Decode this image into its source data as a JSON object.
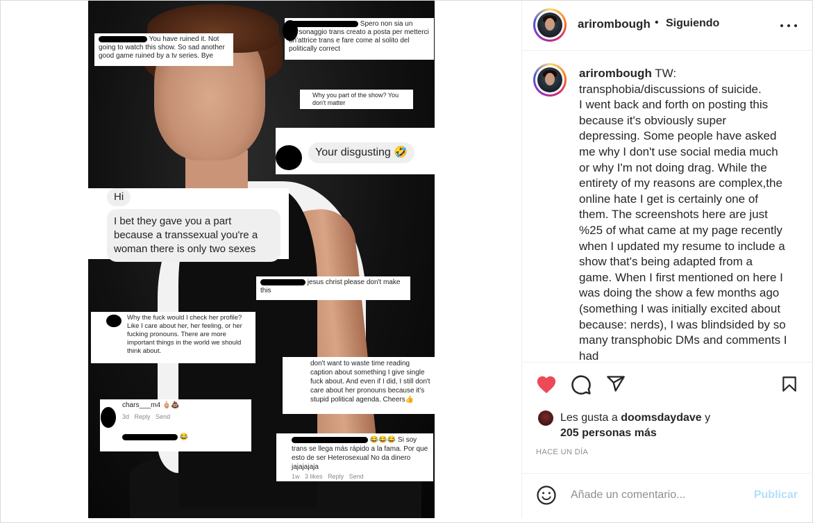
{
  "post": {
    "username": "arirombough",
    "dot": "•",
    "following_label": "Siguiendo",
    "caption_prefix": "TW:",
    "caption": "transphobia/discussions of suicide.\nI went back and forth on posting this because it's obviously super depressing. Some people have asked me why I don't use social media much or why I'm not doing drag. While the entirety of my reasons are complex,the online hate I get is certainly one of them. The screenshots here are just %25 of what came at my page recently when I updated my resume to include a show that's being adapted from a game. When I first mentioned on here I was doing the show a few months ago (something I was initially excited about because: nerds), I was blindsided by so many transphobic DMs and comments I had",
    "likes_prefix": "Les gusta a",
    "likes_user": "doomsdaydave",
    "likes_and": "y",
    "likes_count": "205 personas más",
    "time": "HACE UN DÍA",
    "comment_placeholder": "Añade un comentario...",
    "publish_label": "Publicar"
  },
  "image_comments": {
    "c1": "You have ruined it. Not going to watch this show. So sad another good game ruined by a tv series. Bye",
    "c2": "Spero non sia un personaggio trans creato a posta per metterci un'attrice trans e fare come al solito del politically correct",
    "c3": "Why you part of the show? You don't matter",
    "c4": "Your disgusting 🤣",
    "c5a": "Hi",
    "c5b": "I bet they gave you a part because a transsexual you're a woman there is only two sexes",
    "c6": "jesus christ please don't make this",
    "c7": "Why the fuck would I check her profile? Like I care about her, her feeling, or her fucking pronouns. There are more important things in the world we should think about.",
    "c8": "don't want to waste time reading caption about something I give single fuck about. And even if I did, I still don't care about her pronouns because it's stupid political agenda. Cheers👍",
    "c9a": "chars___m4 🖕🏼💩",
    "c9b": "3d",
    "c9c": "Reply",
    "c9d": "Send",
    "c10": "😂",
    "c11": "😂😂😂 Si soy trans se llega más rápido a la fama. Por que esto de ser Heterosexual No da dinero jajajajaja",
    "c11b": "1w",
    "c11c": "3 likes",
    "c11d": "Reply",
    "c11e": "Send"
  },
  "colors": {
    "heart": "#ed4956",
    "publish": "#b2dffc",
    "muted": "#8e8e8e"
  }
}
